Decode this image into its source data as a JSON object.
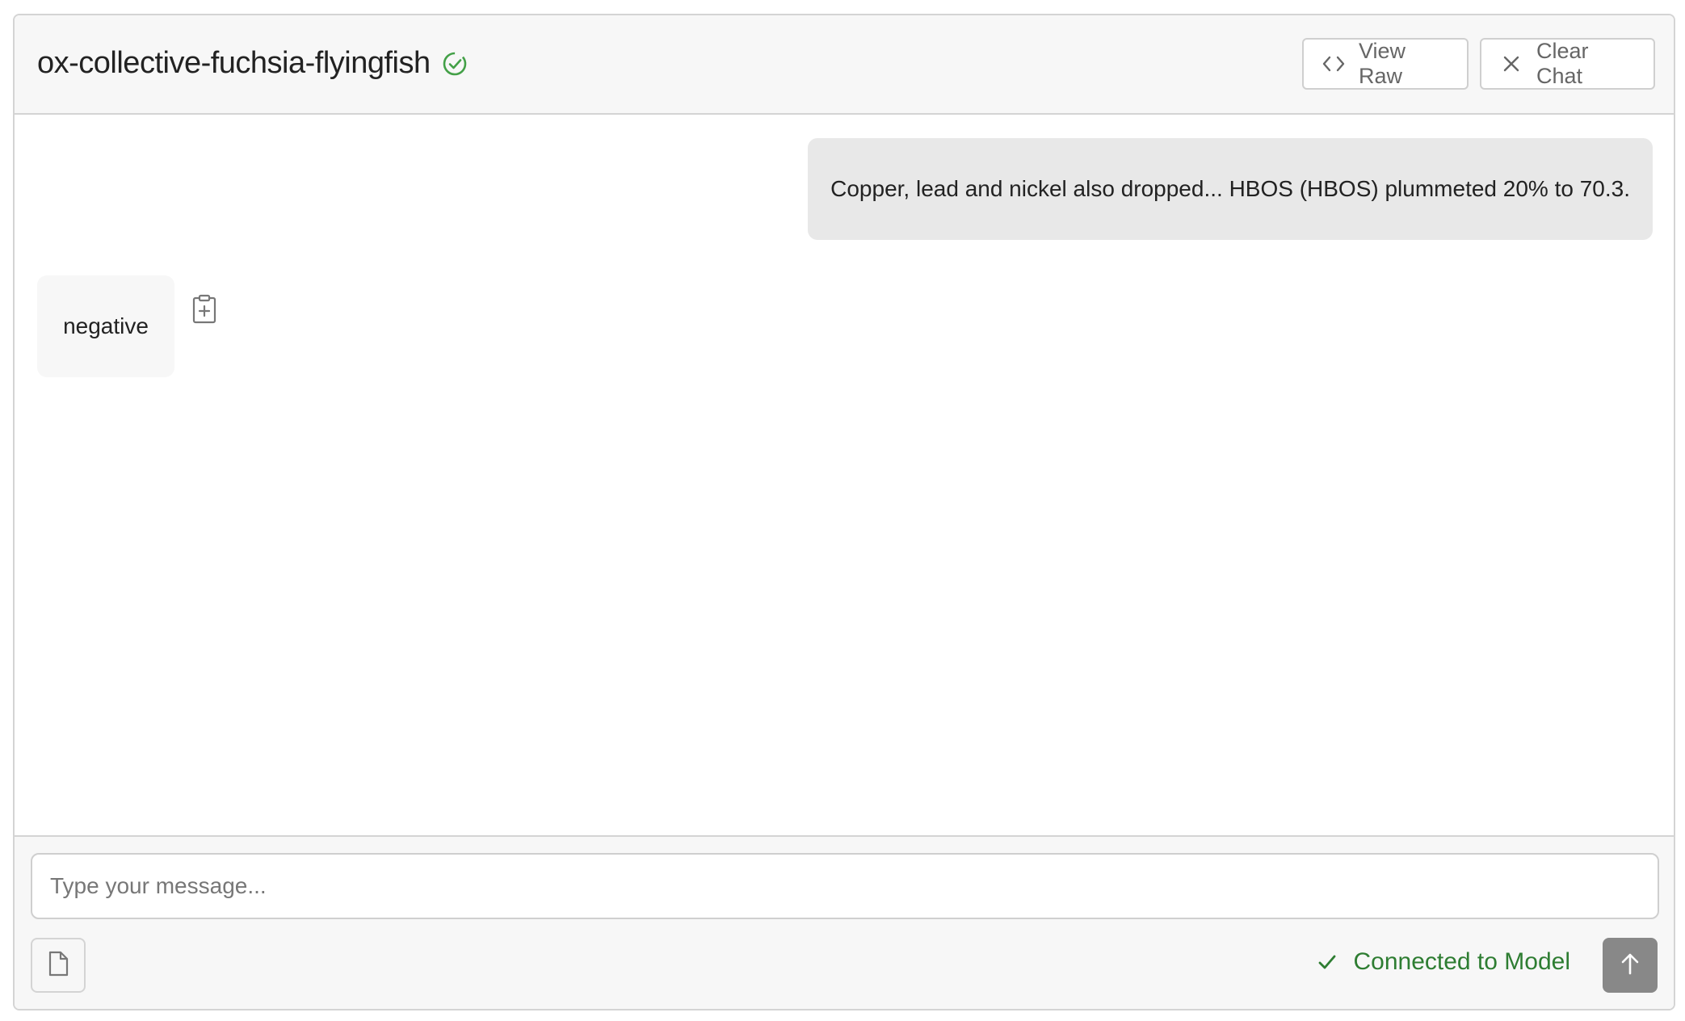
{
  "header": {
    "title": "ox-collective-fuchsia-flyingfish",
    "view_raw_label": "View Raw",
    "clear_chat_label": "Clear Chat"
  },
  "messages": [
    {
      "role": "user",
      "text": "Copper, lead and nickel also dropped... HBOS (HBOS) plummeted 20% to 70.3."
    },
    {
      "role": "assistant",
      "text": "negative"
    }
  ],
  "composer": {
    "placeholder": "Type your message...",
    "value": ""
  },
  "status": {
    "text": "Connected to Model"
  },
  "colors": {
    "status_green": "#2e7d32",
    "verified_green": "#43a047",
    "send_button": "#888888"
  },
  "icons": {
    "verified": "check-circle-icon",
    "view_raw": "code-icon",
    "clear_chat": "close-icon",
    "copy": "clipboard-plus-icon",
    "attach": "file-icon",
    "status": "check-icon",
    "send": "arrow-up-icon"
  }
}
